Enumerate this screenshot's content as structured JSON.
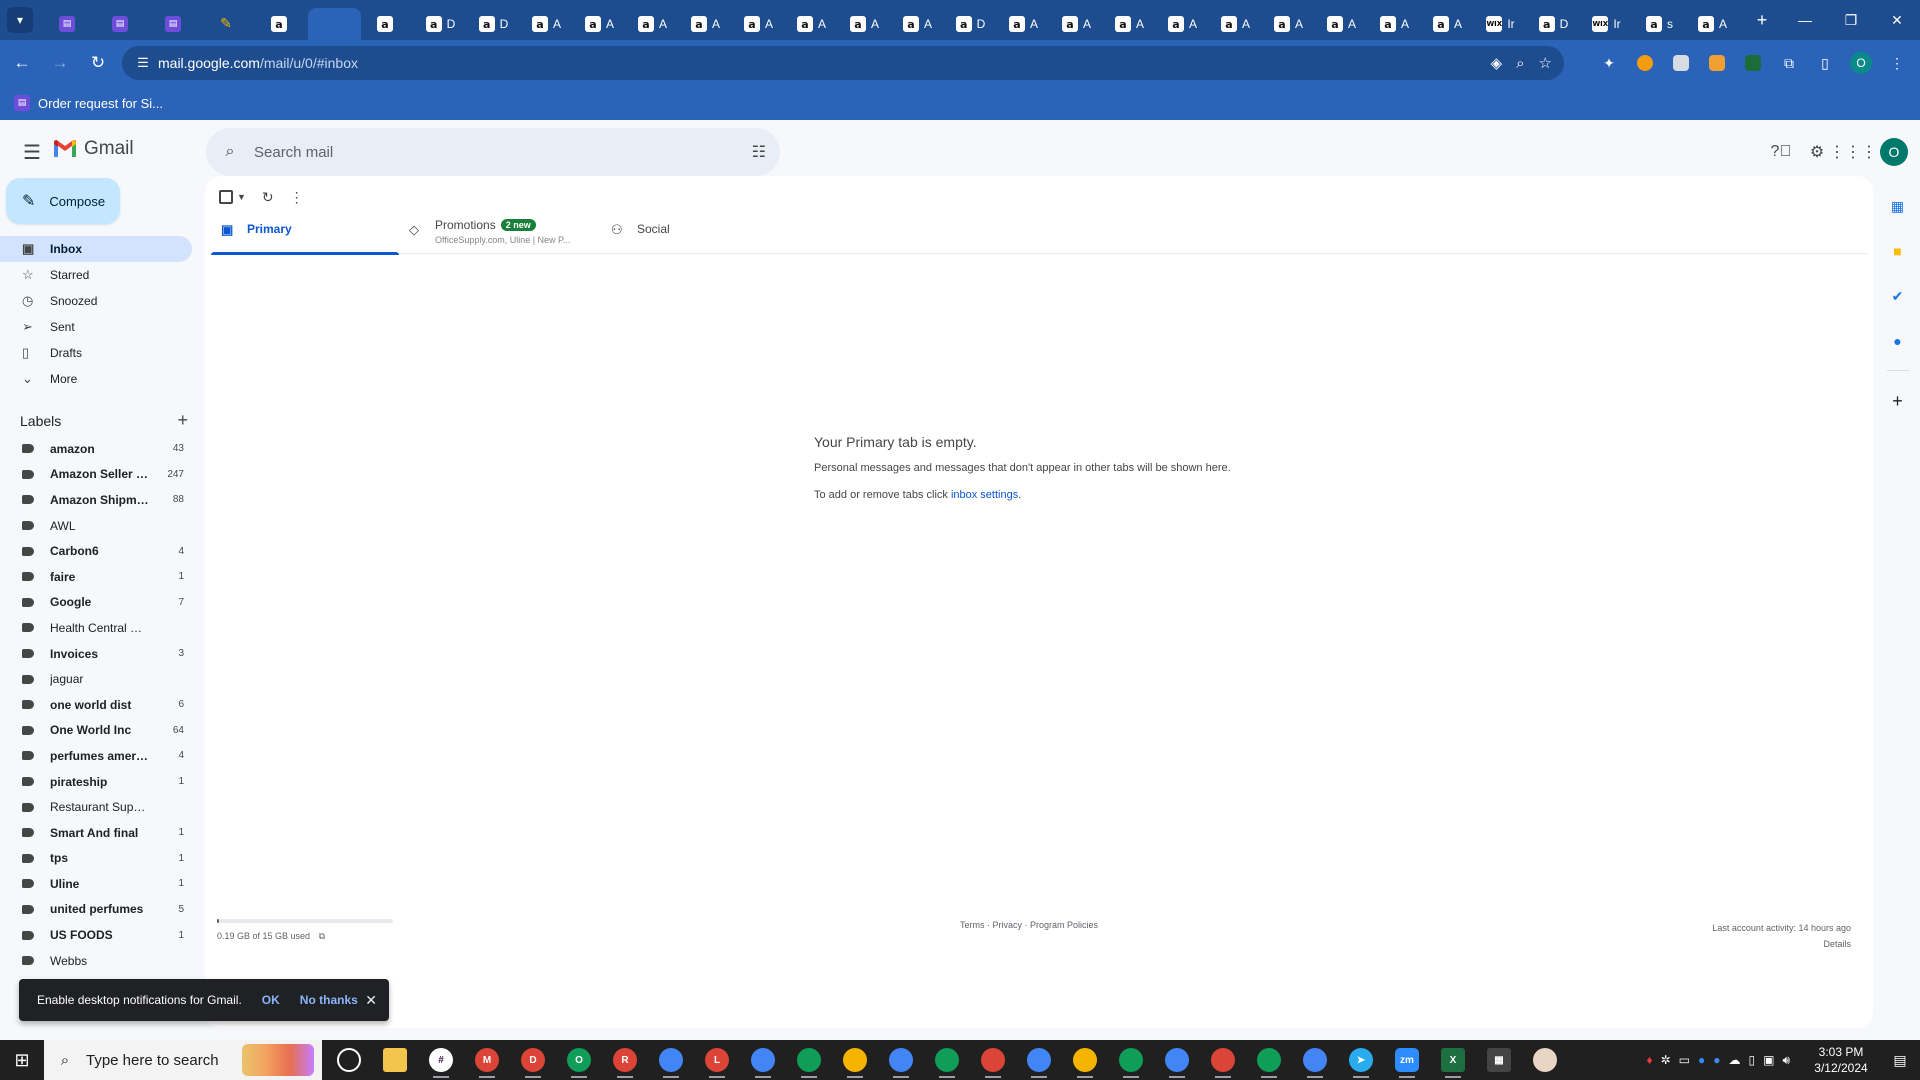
{
  "browser": {
    "tabs": [
      {
        "icon": "sheets-icon",
        "text": ""
      },
      {
        "icon": "sheets-icon",
        "text": ""
      },
      {
        "icon": "sheets-icon",
        "text": ""
      },
      {
        "icon": "tool-icon",
        "text": ""
      },
      {
        "icon": "amazon-icon",
        "text": ""
      },
      {
        "icon": "gmail-icon",
        "text": "",
        "active": true
      },
      {
        "icon": "amazon-icon",
        "text": ""
      },
      {
        "icon": "amazon-icon",
        "text": "D"
      },
      {
        "icon": "amazon-icon",
        "text": "D"
      },
      {
        "icon": "amazon-icon",
        "text": "A"
      },
      {
        "icon": "amazon-icon",
        "text": "A"
      },
      {
        "icon": "amazon-icon",
        "text": "A"
      },
      {
        "icon": "amazon-icon",
        "text": "A"
      },
      {
        "icon": "amazon-icon",
        "text": "A"
      },
      {
        "icon": "amazon-icon",
        "text": "A"
      },
      {
        "icon": "amazon-icon",
        "text": "A"
      },
      {
        "icon": "amazon-icon",
        "text": "A"
      },
      {
        "icon": "amazon-icon",
        "text": "D"
      },
      {
        "icon": "amazon-icon",
        "text": "A"
      },
      {
        "icon": "amazon-icon",
        "text": "A"
      },
      {
        "icon": "amazon-icon",
        "text": "A"
      },
      {
        "icon": "amazon-icon",
        "text": "A"
      },
      {
        "icon": "amazon-icon",
        "text": "A"
      },
      {
        "icon": "amazon-icon",
        "text": "A"
      },
      {
        "icon": "amazon-icon",
        "text": "A"
      },
      {
        "icon": "amazon-icon",
        "text": "A"
      },
      {
        "icon": "amazon-icon",
        "text": "A"
      },
      {
        "icon": "wix-icon",
        "text": "Ir"
      },
      {
        "icon": "amazon-icon",
        "text": "D"
      },
      {
        "icon": "wix-icon",
        "text": "Ir"
      },
      {
        "icon": "amazon-icon",
        "text": "s"
      },
      {
        "icon": "amazon-icon",
        "text": "A"
      }
    ],
    "url_host": "mail.google.com",
    "url_path": "/mail/u/0/#inbox",
    "bookmark": "Order request for Si...",
    "profile_initial": "O"
  },
  "gmail": {
    "product_name": "Gmail",
    "search_placeholder": "Search mail",
    "compose_label": "Compose",
    "account_initial": "O",
    "nav": [
      {
        "label": "Inbox",
        "icon": "inbox-icon",
        "active": true
      },
      {
        "label": "Starred",
        "icon": "star-icon"
      },
      {
        "label": "Snoozed",
        "icon": "clock-icon"
      },
      {
        "label": "Sent",
        "icon": "send-icon"
      },
      {
        "label": "Drafts",
        "icon": "draft-icon"
      },
      {
        "label": "More",
        "icon": "chevron-down-icon"
      }
    ],
    "labels_title": "Labels",
    "labels": [
      {
        "name": "amazon",
        "count": "43",
        "bold": true
      },
      {
        "name": "Amazon Seller C...",
        "count": "247",
        "bold": true
      },
      {
        "name": "Amazon Shipment",
        "count": "88",
        "bold": true
      },
      {
        "name": "AWL",
        "count": "",
        "bold": false
      },
      {
        "name": "Carbon6",
        "count": "4",
        "bold": true
      },
      {
        "name": "faire",
        "count": "1",
        "bold": true
      },
      {
        "name": "Google",
        "count": "7",
        "bold": true
      },
      {
        "name": "Health Central USA",
        "count": "",
        "bold": false
      },
      {
        "name": "Invoices",
        "count": "3",
        "bold": true
      },
      {
        "name": "jaguar",
        "count": "",
        "bold": false
      },
      {
        "name": "one world dist",
        "count": "6",
        "bold": true
      },
      {
        "name": "One World Inc",
        "count": "64",
        "bold": true
      },
      {
        "name": "perfumes america",
        "count": "4",
        "bold": true
      },
      {
        "name": "pirateship",
        "count": "1",
        "bold": true
      },
      {
        "name": "Restaurant Supply D",
        "count": "",
        "bold": false
      },
      {
        "name": "Smart And final",
        "count": "1",
        "bold": true
      },
      {
        "name": "tps",
        "count": "1",
        "bold": true
      },
      {
        "name": "Uline",
        "count": "1",
        "bold": true
      },
      {
        "name": "united perfumes",
        "count": "5",
        "bold": true
      },
      {
        "name": "US FOODS",
        "count": "1",
        "bold": true
      },
      {
        "name": "Webbs",
        "count": "",
        "bold": false
      }
    ],
    "tabs": {
      "primary": "Primary",
      "promotions": "Promotions",
      "promotions_badge": "2 new",
      "promotions_sub": "OfficeSupply.com, Uline | New P...",
      "social": "Social"
    },
    "empty_state": {
      "title": "Your Primary tab is empty.",
      "line1": "Personal messages and messages that don't appear in other tabs will be shown here.",
      "line2_prefix": "To add or remove tabs click ",
      "line2_link": "inbox settings",
      "line2_suffix": "."
    },
    "footer": {
      "storage": "0.19 GB of 15 GB used",
      "storage_fraction": 0.013,
      "links": "Terms · Privacy · Program Policies",
      "last_activity": "Last account activity: 14 hours ago",
      "details": "Details"
    },
    "toast": {
      "message": "Enable desktop notifications for Gmail.",
      "ok": "OK",
      "no_thanks": "No thanks"
    }
  },
  "taskbar": {
    "search_placeholder": "Type here to search",
    "time": "3:03 PM",
    "date": "3/12/2024"
  }
}
